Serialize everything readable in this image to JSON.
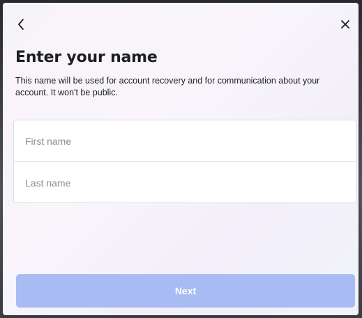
{
  "header": {
    "back_icon": "chevron-left-icon",
    "close_icon": "close-icon"
  },
  "title": "Enter your name",
  "description": "This name will be used for account recovery and for communication about your account. It won't be public.",
  "form": {
    "first_name": {
      "value": "",
      "placeholder": "First name"
    },
    "last_name": {
      "value": "",
      "placeholder": "Last name"
    }
  },
  "next_button": {
    "label": "Next",
    "color": "#a8bbf2"
  }
}
